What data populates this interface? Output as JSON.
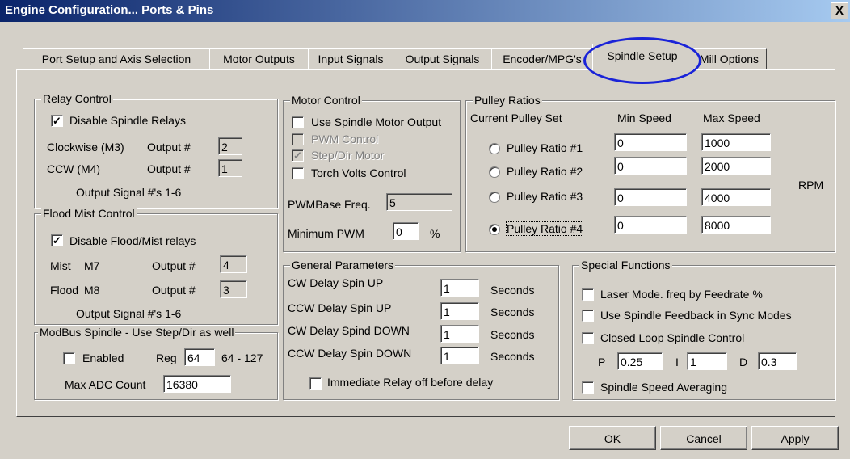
{
  "window": {
    "title": "Engine Configuration... Ports & Pins",
    "close": "X"
  },
  "tabs": [
    "Port Setup and Axis Selection",
    "Motor Outputs",
    "Input Signals",
    "Output Signals",
    "Encoder/MPG's",
    "Spindle Setup",
    "Mill Options"
  ],
  "active_tab": "Spindle Setup",
  "relay": {
    "legend": "Relay Control",
    "disable_label": "Disable Spindle Relays",
    "disable_checked": "✓",
    "cw_label": "Clockwise (M3)",
    "cw_out": "Output #",
    "cw_value": "2",
    "ccw_label": "CCW (M4)",
    "ccw_out": "Output #",
    "ccw_value": "1",
    "note": "Output Signal #'s 1-6"
  },
  "flood": {
    "legend": "Flood Mist Control",
    "disable_label": "Disable Flood/Mist relays",
    "disable_checked": "✓",
    "mist_label": "Mist",
    "mist_code": "M7",
    "mist_out": "Output #",
    "mist_value": "4",
    "flood_label": "Flood",
    "flood_code": "M8",
    "flood_out": "Output #",
    "flood_value": "3",
    "note": "Output Signal #'s 1-6"
  },
  "modbus": {
    "legend": "ModBus Spindle - Use Step/Dir as well",
    "enabled_label": "Enabled",
    "reg_label": "Reg",
    "reg_value": "64",
    "reg_range": "64 - 127",
    "adc_label": "Max ADC Count",
    "adc_value": "16380"
  },
  "motor": {
    "legend": "Motor Control",
    "use_spindle": "Use Spindle Motor Output",
    "pwm_control": "PWM Control",
    "step_dir": "Step/Dir Motor",
    "step_dir_checked": "✓",
    "torch": "Torch Volts Control",
    "pwm_base_label": "PWMBase Freq.",
    "pwm_base_value": "5",
    "min_pwm_label": "Minimum PWM",
    "min_pwm_value": "0",
    "min_pwm_unit": "%"
  },
  "pulley": {
    "legend": "Pulley Ratios",
    "current_label": "Current Pulley Set",
    "min_header": "Min Speed",
    "max_header": "Max Speed",
    "unit": "RPM",
    "selected": 4,
    "rows": [
      {
        "label": "Pulley Ratio #1",
        "min": "0",
        "max": "1000"
      },
      {
        "label": "Pulley Ratio #2",
        "min": "0",
        "max": "2000"
      },
      {
        "label": "Pulley Ratio #3",
        "min": "0",
        "max": "4000"
      },
      {
        "label": "Pulley Ratio #4",
        "min": "0",
        "max": "8000"
      }
    ]
  },
  "general": {
    "legend": "General Parameters",
    "rows": [
      {
        "label": "CW Delay Spin UP",
        "value": "1",
        "unit": "Seconds"
      },
      {
        "label": "CCW Delay Spin UP",
        "value": "1",
        "unit": "Seconds"
      },
      {
        "label": "CW Delay Spind DOWN",
        "value": "1",
        "unit": "Seconds"
      },
      {
        "label": "CCW Delay Spin DOWN",
        "value": "1",
        "unit": "Seconds"
      }
    ],
    "immediate_label": "Immediate Relay off before delay"
  },
  "special": {
    "legend": "Special Functions",
    "laser": "Laser Mode. freq by Feedrate %",
    "feedback": "Use Spindle Feedback in Sync Modes",
    "closed_loop": "Closed Loop Spindle Control",
    "p_label": "P",
    "p_value": "0.25",
    "i_label": "I",
    "i_value": "1",
    "d_label": "D",
    "d_value": "0.3",
    "averaging": "Spindle Speed Averaging"
  },
  "buttons": {
    "ok": "OK",
    "cancel": "Cancel",
    "apply": "Apply"
  },
  "colors": {
    "titlebar_start": "#0a246a",
    "titlebar_end": "#a6caf0",
    "face": "#d4d0c8",
    "highlight_circle": "#1a23d8"
  }
}
